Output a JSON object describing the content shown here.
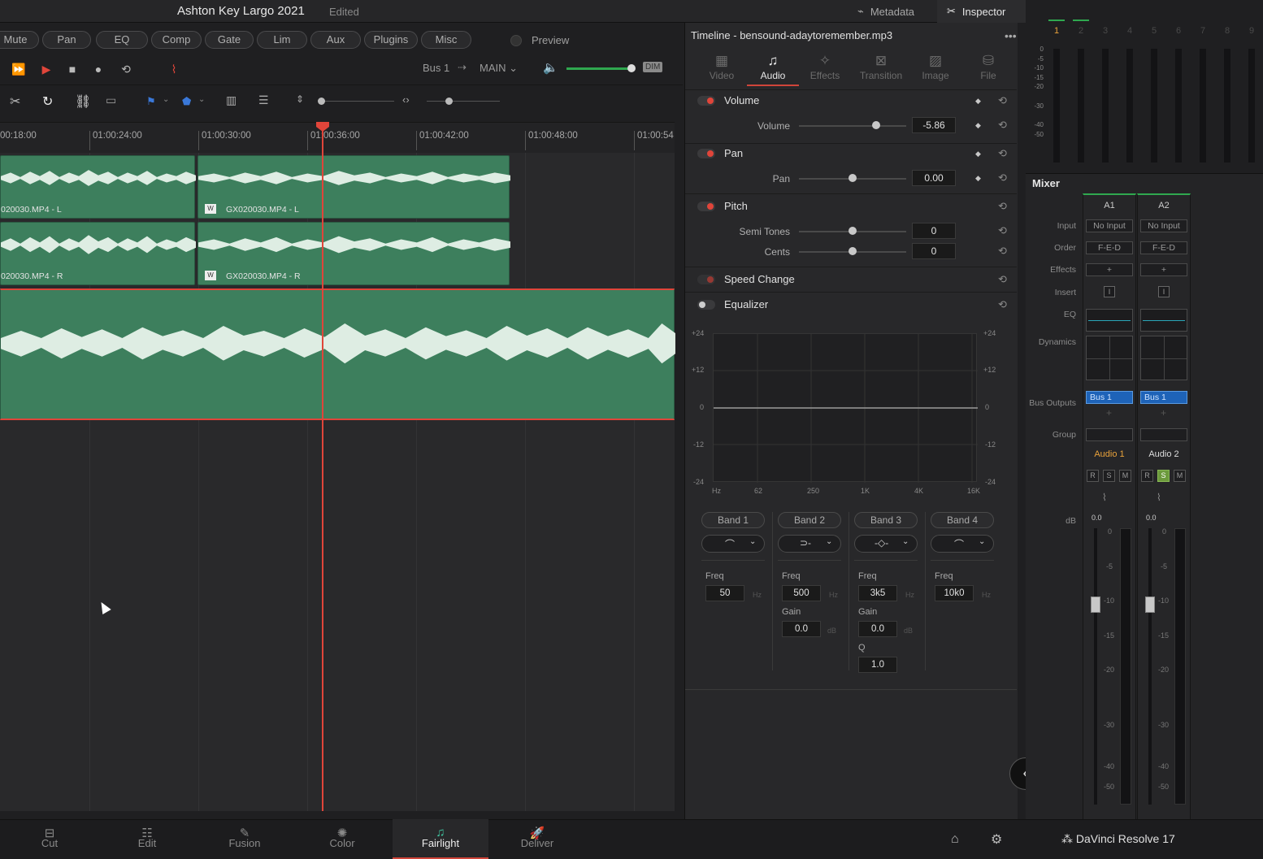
{
  "header": {
    "title": "Ashton Key Largo 2021",
    "status": "Edited",
    "metadata_label": "Metadata",
    "inspector_label": "Inspector"
  },
  "filters": [
    "Mute",
    "Pan",
    "EQ",
    "Comp",
    "Gate",
    "Lim",
    "Aux",
    "Plugins",
    "Misc"
  ],
  "preview_label": "Preview",
  "transport": {
    "bus_label": "Bus 1",
    "main_label": "MAIN",
    "dim_label": "DIM"
  },
  "ruler": [
    "00:18:00",
    "01:00:24:00",
    "01:00:30:00",
    "01:00:36:00",
    "01:00:42:00",
    "01:00:48:00",
    "01:00:54"
  ],
  "clips": [
    {
      "name": "GX020030.MP4 - L"
    },
    {
      "name": "GX020030.MP4 - L"
    },
    {
      "name": "GX020030.MP4 - R"
    },
    {
      "name": "GX020030.MP4 - R"
    }
  ],
  "clip_partial_labels": [
    "020030.MP4 - L",
    "020030.MP4 - R"
  ],
  "inspector": {
    "title": "Timeline - bensound-adaytoremember.mp3",
    "tabs": [
      {
        "label": "Video",
        "icon": "film-icon"
      },
      {
        "label": "Audio",
        "icon": "music-note-icon"
      },
      {
        "label": "Effects",
        "icon": "wand-icon"
      },
      {
        "label": "Transition",
        "icon": "transition-icon"
      },
      {
        "label": "Image",
        "icon": "image-icon"
      },
      {
        "label": "File",
        "icon": "file-icon"
      }
    ],
    "volume": {
      "section": "Volume",
      "label": "Volume",
      "value": "-5.86"
    },
    "pan": {
      "section": "Pan",
      "label": "Pan",
      "value": "0.00"
    },
    "pitch": {
      "section": "Pitch",
      "semitones_label": "Semi Tones",
      "semitones": "0",
      "cents_label": "Cents",
      "cents": "0"
    },
    "speed_change": "Speed Change",
    "equalizer": {
      "section": "Equalizer",
      "y_labels": [
        "+24",
        "+12",
        "0",
        "-12",
        "-24"
      ],
      "x_labels": [
        "Hz",
        "62",
        "250",
        "1K",
        "4K",
        "16K"
      ],
      "bands": [
        {
          "label": "Band 1",
          "freq_label": "Freq",
          "freq": "50",
          "unit": "Hz"
        },
        {
          "label": "Band 2",
          "freq_label": "Freq",
          "freq": "500",
          "unit": "Hz",
          "gain_label": "Gain",
          "gain": "0.0",
          "gain_unit": "dB"
        },
        {
          "label": "Band 3",
          "freq_label": "Freq",
          "freq": "3k5",
          "unit": "Hz",
          "gain_label": "Gain",
          "gain": "0.0",
          "gain_unit": "dB",
          "q_label": "Q",
          "q": "1.0"
        },
        {
          "label": "Band 4",
          "freq_label": "Freq",
          "freq": "10k0",
          "unit": "Hz"
        }
      ]
    }
  },
  "meters": {
    "channels": [
      "1",
      "2",
      "3",
      "4",
      "5",
      "6",
      "7",
      "8",
      "9"
    ],
    "scale": [
      "0",
      "-5",
      "-10",
      "-15",
      "-20",
      "-30",
      "-40",
      "-50"
    ]
  },
  "mixer": {
    "title": "Mixer",
    "row_labels": {
      "input": "Input",
      "order": "Order",
      "effects": "Effects",
      "insert": "Insert",
      "eq": "EQ",
      "dynamics": "Dynamics",
      "bus_outputs": "Bus Outputs",
      "group": "Group",
      "db": "dB"
    },
    "channels": [
      {
        "id": "A1",
        "input": "No Input",
        "order": "F-E-D",
        "bus": "Bus 1",
        "name": "Audio 1",
        "fader_db": "0.0"
      },
      {
        "id": "A2",
        "input": "No Input",
        "order": "F-E-D",
        "bus": "Bus 1",
        "name": "Audio 2",
        "fader_db": "0.0"
      }
    ],
    "fader_scale": [
      "0",
      "-5",
      "-10",
      "-15",
      "-20",
      "-30",
      "-40",
      "-50"
    ],
    "colors": {
      "audio1": "#e9a23b",
      "audio2": "#dddddd",
      "solo_active": "#6c9a3c"
    }
  },
  "pages": [
    {
      "label": "Cut",
      "icon": "cut-page-icon"
    },
    {
      "label": "Edit",
      "icon": "edit-page-icon"
    },
    {
      "label": "Fusion",
      "icon": "fusion-page-icon"
    },
    {
      "label": "Color",
      "icon": "color-page-icon"
    },
    {
      "label": "Fairlight",
      "icon": "fairlight-page-icon"
    },
    {
      "label": "Deliver",
      "icon": "deliver-page-icon"
    }
  ],
  "active_page": "Fairlight",
  "app_name": "DaVinci Resolve 17",
  "colors": {
    "accent": "#d0453a",
    "clip": "#3d7f5d",
    "playhead": "#e0453a"
  }
}
